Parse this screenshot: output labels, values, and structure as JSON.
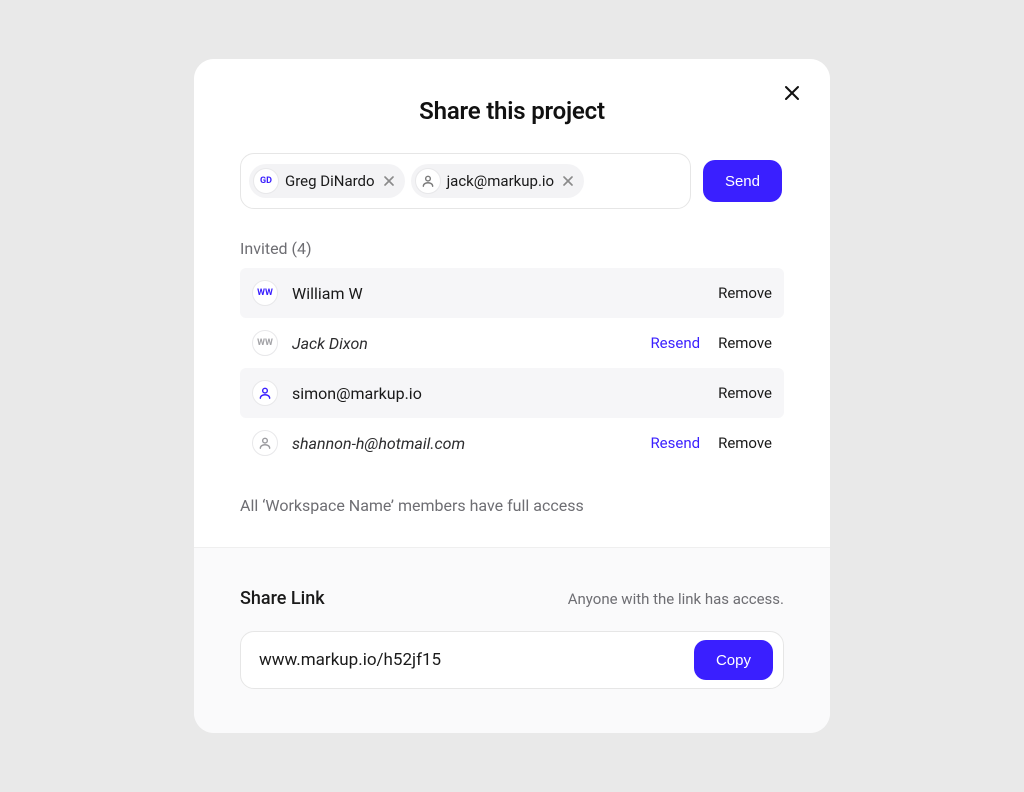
{
  "dialog": {
    "title": "Share this project",
    "send_label": "Send"
  },
  "chips": [
    {
      "avatar_text": "GD",
      "label": "Greg DiNardo",
      "type": "initials"
    },
    {
      "avatar_text": "",
      "label": "jack@markup.io",
      "type": "person"
    }
  ],
  "invited": {
    "header": "Invited (4)",
    "resend_label": "Resend",
    "remove_label": "Remove",
    "rows": [
      {
        "avatar_text": "WW",
        "avatar_type": "initials",
        "name": "William W",
        "italic": false,
        "show_resend": false
      },
      {
        "avatar_text": "WW",
        "avatar_type": "initials-gray",
        "name": "Jack Dixon",
        "italic": true,
        "show_resend": true
      },
      {
        "avatar_text": "",
        "avatar_type": "person-blue",
        "name": "simon@markup.io",
        "italic": false,
        "show_resend": false
      },
      {
        "avatar_text": "",
        "avatar_type": "person-gray",
        "name": "shannon-h@hotmail.com",
        "italic": true,
        "show_resend": true
      }
    ]
  },
  "workspace_note": "All ‘Workspace Name’ members have full access",
  "share_link": {
    "title": "Share Link",
    "note": "Anyone with the link has access.",
    "url": "www.markup.io/h52jf15",
    "copy_label": "Copy"
  }
}
